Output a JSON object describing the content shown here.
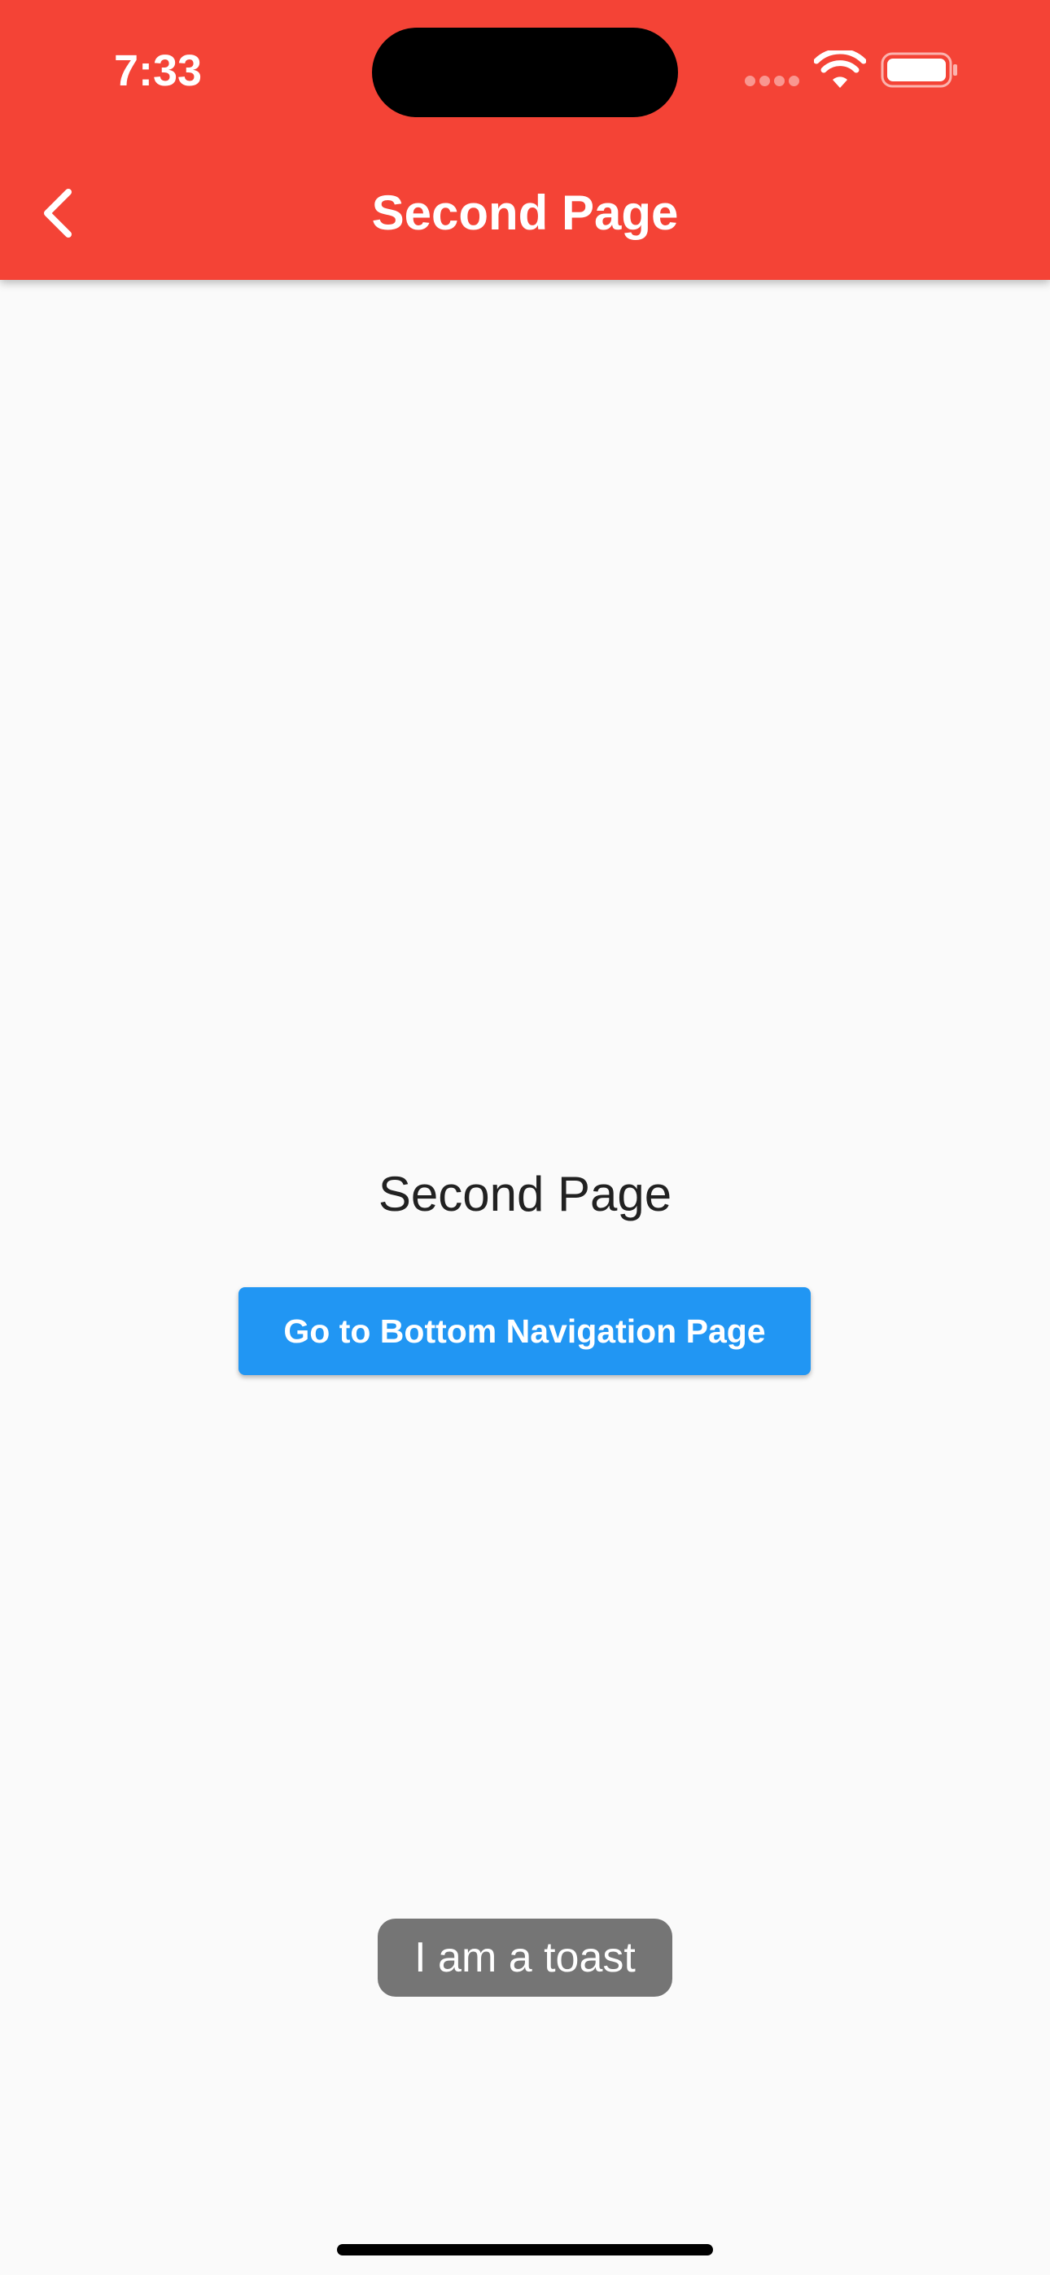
{
  "status_bar": {
    "time": "7:33",
    "battery_icon": "battery-full-icon",
    "wifi_icon": "wifi-icon",
    "signal_icon": "cellular-signal-icon"
  },
  "app_bar": {
    "title": "Second Page",
    "back_icon": "chevron-left-icon",
    "background_color": "#F44336"
  },
  "main": {
    "title": "Second Page",
    "button_label": "Go to Bottom Navigation Page",
    "button_color": "#2196F3"
  },
  "toast": {
    "message": "I am a toast"
  }
}
